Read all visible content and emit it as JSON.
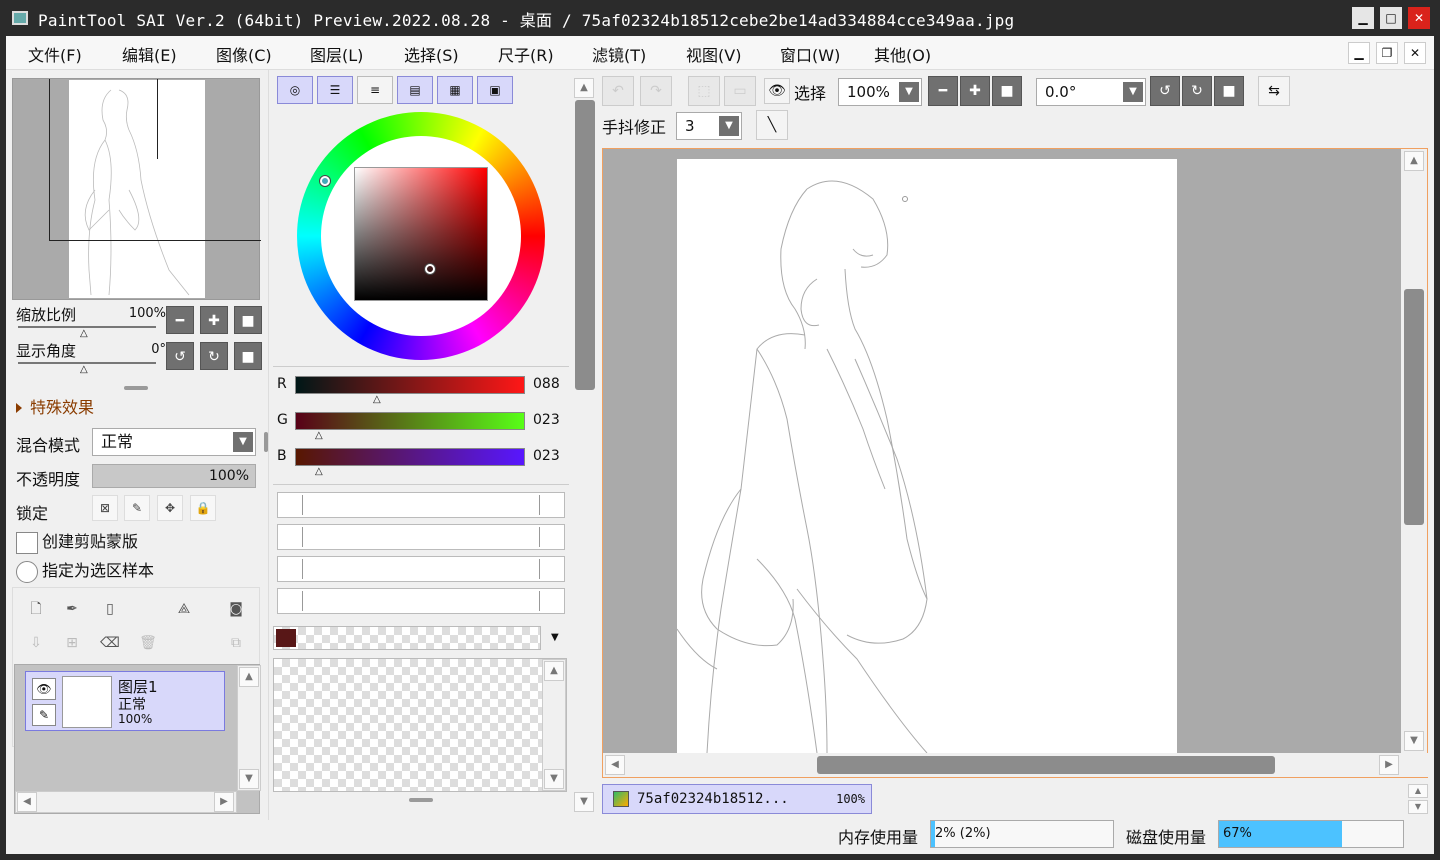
{
  "window": {
    "title": "PaintTool SAI Ver.2 (64bit) Preview.2022.08.28 - 桌面 / 75af02324b18512cebe2be14ad334884cce349aa.jpg",
    "minimize": "▁",
    "maximize": "□",
    "close": "✕"
  },
  "menu": {
    "items": [
      "文件(F)",
      "编辑(E)",
      "图像(C)",
      "图层(L)",
      "选择(S)",
      "尺子(R)",
      "滤镜(T)",
      "视图(V)",
      "窗口(W)",
      "其他(O)"
    ],
    "mdi_minimize": "▁",
    "mdi_restore": "❐",
    "mdi_close": "✕"
  },
  "navigator": {
    "zoom_label": "缩放比例",
    "zoom_value": "100%",
    "angle_label": "显示角度",
    "angle_value": "0°"
  },
  "layer_props": {
    "section": "特殊效果",
    "blend_label": "混合模式",
    "blend_value": "正常",
    "opacity_label": "不透明度",
    "opacity_value": "100%",
    "lock_label": "锁定",
    "clip_label": "创建剪贴蒙版",
    "select_source_label": "指定为选区样本"
  },
  "layers": [
    {
      "name": "图层1",
      "mode": "正常",
      "opacity": "100%"
    }
  ],
  "color": {
    "r": {
      "label": "R",
      "value": "088"
    },
    "g": {
      "label": "G",
      "value": "023"
    },
    "b": {
      "label": "B",
      "value": "023"
    },
    "current": "#581717"
  },
  "toolbar": {
    "select_label": "选择",
    "zoom": "100%",
    "angle": "0.0°",
    "stabilizer_label": "手抖修正",
    "stabilizer_value": "3"
  },
  "document": {
    "tab_name": "75af02324b18512...",
    "tab_zoom": "100%"
  },
  "status": {
    "memory_label": "内存使用量",
    "memory_value": "2% (2%)",
    "memory_fraction": 0.02,
    "disk_label": "磁盘使用量",
    "disk_value": "67%",
    "disk_fraction": 0.67
  }
}
